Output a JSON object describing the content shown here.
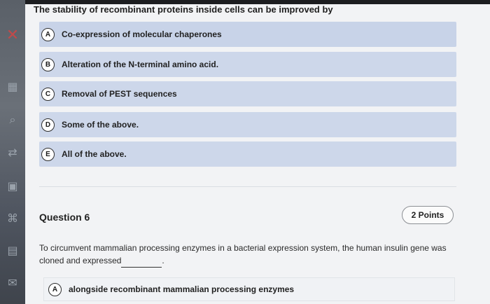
{
  "question5": {
    "stem": "The stability of recombinant proteins inside cells can be improved by",
    "options": [
      {
        "letter": "A",
        "text": "Co-expression of molecular chaperones"
      },
      {
        "letter": "B",
        "text": "Alteration of the N-terminal amino acid."
      },
      {
        "letter": "C",
        "text": "Removal of PEST sequences"
      },
      {
        "letter": "D",
        "text": "Some of the above."
      },
      {
        "letter": "E",
        "text": "All of the above."
      }
    ]
  },
  "question6": {
    "title": "Question 6",
    "points": "2 Points",
    "stem_before_blank": "To circumvent mammalian processing enzymes in a bacterial expression system, the human insulin gene was cloned and expressed",
    "stem_after_blank": ".",
    "options": [
      {
        "letter": "A",
        "text": "alongside recombinant mammalian processing enzymes"
      }
    ]
  },
  "rail": {
    "icons": [
      "close-icon",
      "table-icon",
      "search-icon",
      "translate-icon",
      "calculator-icon",
      "hanzi-icon",
      "grid-icon",
      "mail-icon"
    ]
  },
  "colors": {
    "option_bg": "#cdd7ea",
    "accent_dark": "#2d2d2d"
  }
}
